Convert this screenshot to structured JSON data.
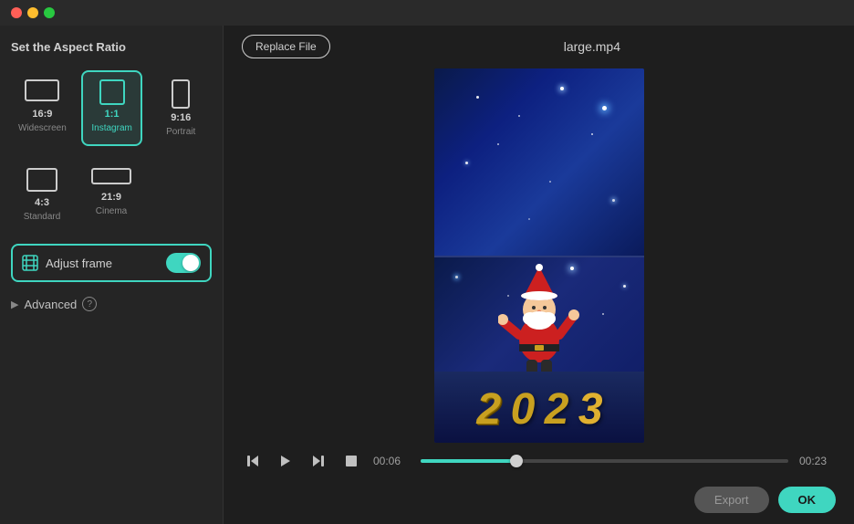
{
  "titlebar": {
    "traffic": [
      "red",
      "yellow",
      "green"
    ]
  },
  "leftPanel": {
    "title": "Set the Aspect Ratio",
    "aspectRatios": [
      {
        "id": "16-9",
        "ratio": "16:9",
        "sub": "Widescreen",
        "selected": false,
        "iconW": 36,
        "iconH": 22
      },
      {
        "id": "1-1",
        "ratio": "1:1",
        "sub": "Instagram",
        "selected": true,
        "iconW": 26,
        "iconH": 26
      },
      {
        "id": "9-16",
        "ratio": "9:16",
        "sub": "Portrait",
        "selected": false,
        "iconW": 18,
        "iconH": 30
      },
      {
        "id": "4-3",
        "ratio": "4:3",
        "sub": "Standard",
        "selected": false,
        "iconW": 32,
        "iconH": 26
      },
      {
        "id": "21-9",
        "ratio": "21:9",
        "sub": "Cinema",
        "selected": false,
        "iconW": 42,
        "iconH": 18
      }
    ],
    "adjustFrame": {
      "label": "Adjust frame",
      "enabled": true
    },
    "advanced": {
      "label": "Advanced",
      "info": "?"
    }
  },
  "topBar": {
    "replaceFile": "Replace File",
    "fileName": "large.mp4"
  },
  "controls": {
    "timeStart": "00:06",
    "timeEnd": "00:23",
    "progressPercent": 26
  },
  "buttons": {
    "ok": "OK",
    "export": "Export"
  },
  "video": {
    "year": "2023"
  }
}
